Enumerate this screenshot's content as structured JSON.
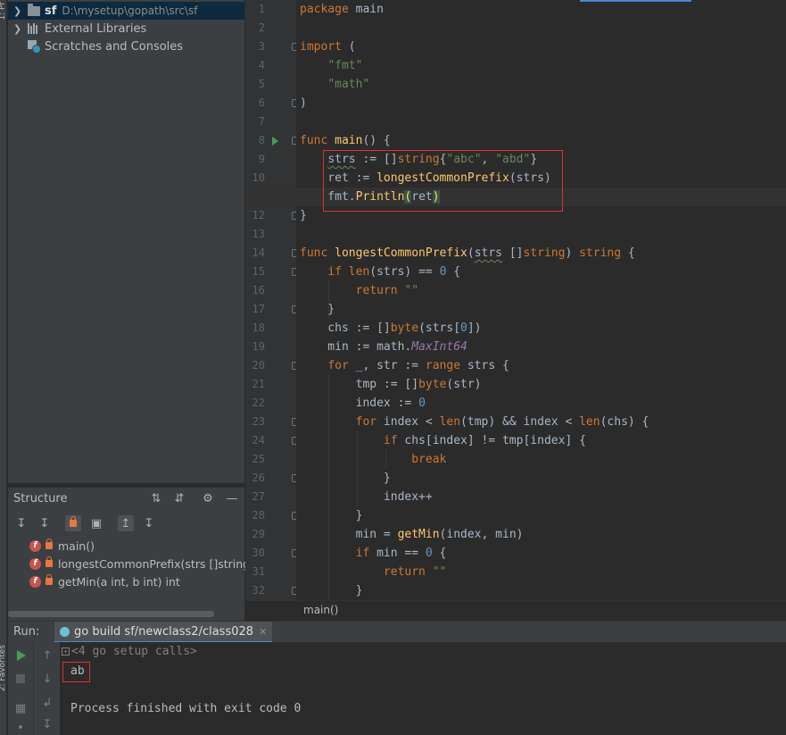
{
  "left_strip": {
    "top_label": "1: Pr",
    "bottom_label": "2: Favorites"
  },
  "project_tree": [
    {
      "name": "sf",
      "path": "D:\\mysetup\\gopath\\src\\sf",
      "selected": true,
      "icon": "folder-icon"
    },
    {
      "name": "External Libraries",
      "icon": "library-icon"
    },
    {
      "name": "Scratches and Consoles",
      "icon": "scratches-icon"
    }
  ],
  "structure": {
    "title": "Structure",
    "items": [
      {
        "label": "main()",
        "icon": "function-icon"
      },
      {
        "label": "longestCommonPrefix(strs []string)",
        "icon": "function-icon"
      },
      {
        "label": "getMin(a int, b int) int",
        "icon": "function-icon"
      }
    ]
  },
  "editor": {
    "current_line": 11,
    "line_numbers": [
      "1",
      "2",
      "3",
      "4",
      "5",
      "6",
      "7",
      "8",
      "9",
      "10",
      "11",
      "12",
      "13",
      "14",
      "15",
      "16",
      "17",
      "18",
      "19",
      "20",
      "21",
      "22",
      "23",
      "24",
      "25",
      "26",
      "27",
      "28",
      "29",
      "30",
      "31",
      "32"
    ],
    "code_lines": [
      "package main",
      "",
      "import (",
      "    \"fmt\"",
      "    \"math\"",
      ")",
      "",
      "func main() {",
      "    strs := []string{\"abc\", \"abd\"}",
      "    ret := longestCommonPrefix(strs)",
      "    fmt.Println(ret)",
      "}",
      "",
      "func longestCommonPrefix(strs []string) string {",
      "    if len(strs) == 0 {",
      "        return \"\"",
      "    }",
      "    chs := []byte(strs[0])",
      "    min := math.MaxInt64",
      "    for _, str := range strs {",
      "        tmp := []byte(str)",
      "        index := 0",
      "        for index < len(tmp) && index < len(chs) {",
      "            if chs[index] != tmp[index] {",
      "                break",
      "            }",
      "            index++",
      "        }",
      "        min = getMin(index, min)",
      "        if min == 0 {",
      "            return \"\"",
      "        }"
    ],
    "breadcrumb": "main()"
  },
  "run": {
    "label": "Run:",
    "tab_title": "go build sf/newclass2/class028",
    "console_lines": [
      "<4 go setup calls>",
      "ab",
      "",
      "Process finished with exit code 0"
    ]
  },
  "colors": {
    "keyword": "#cc7832",
    "string": "#6a8759",
    "function": "#ffc66d",
    "number": "#6897bb",
    "highlight_box": "#e03030"
  }
}
